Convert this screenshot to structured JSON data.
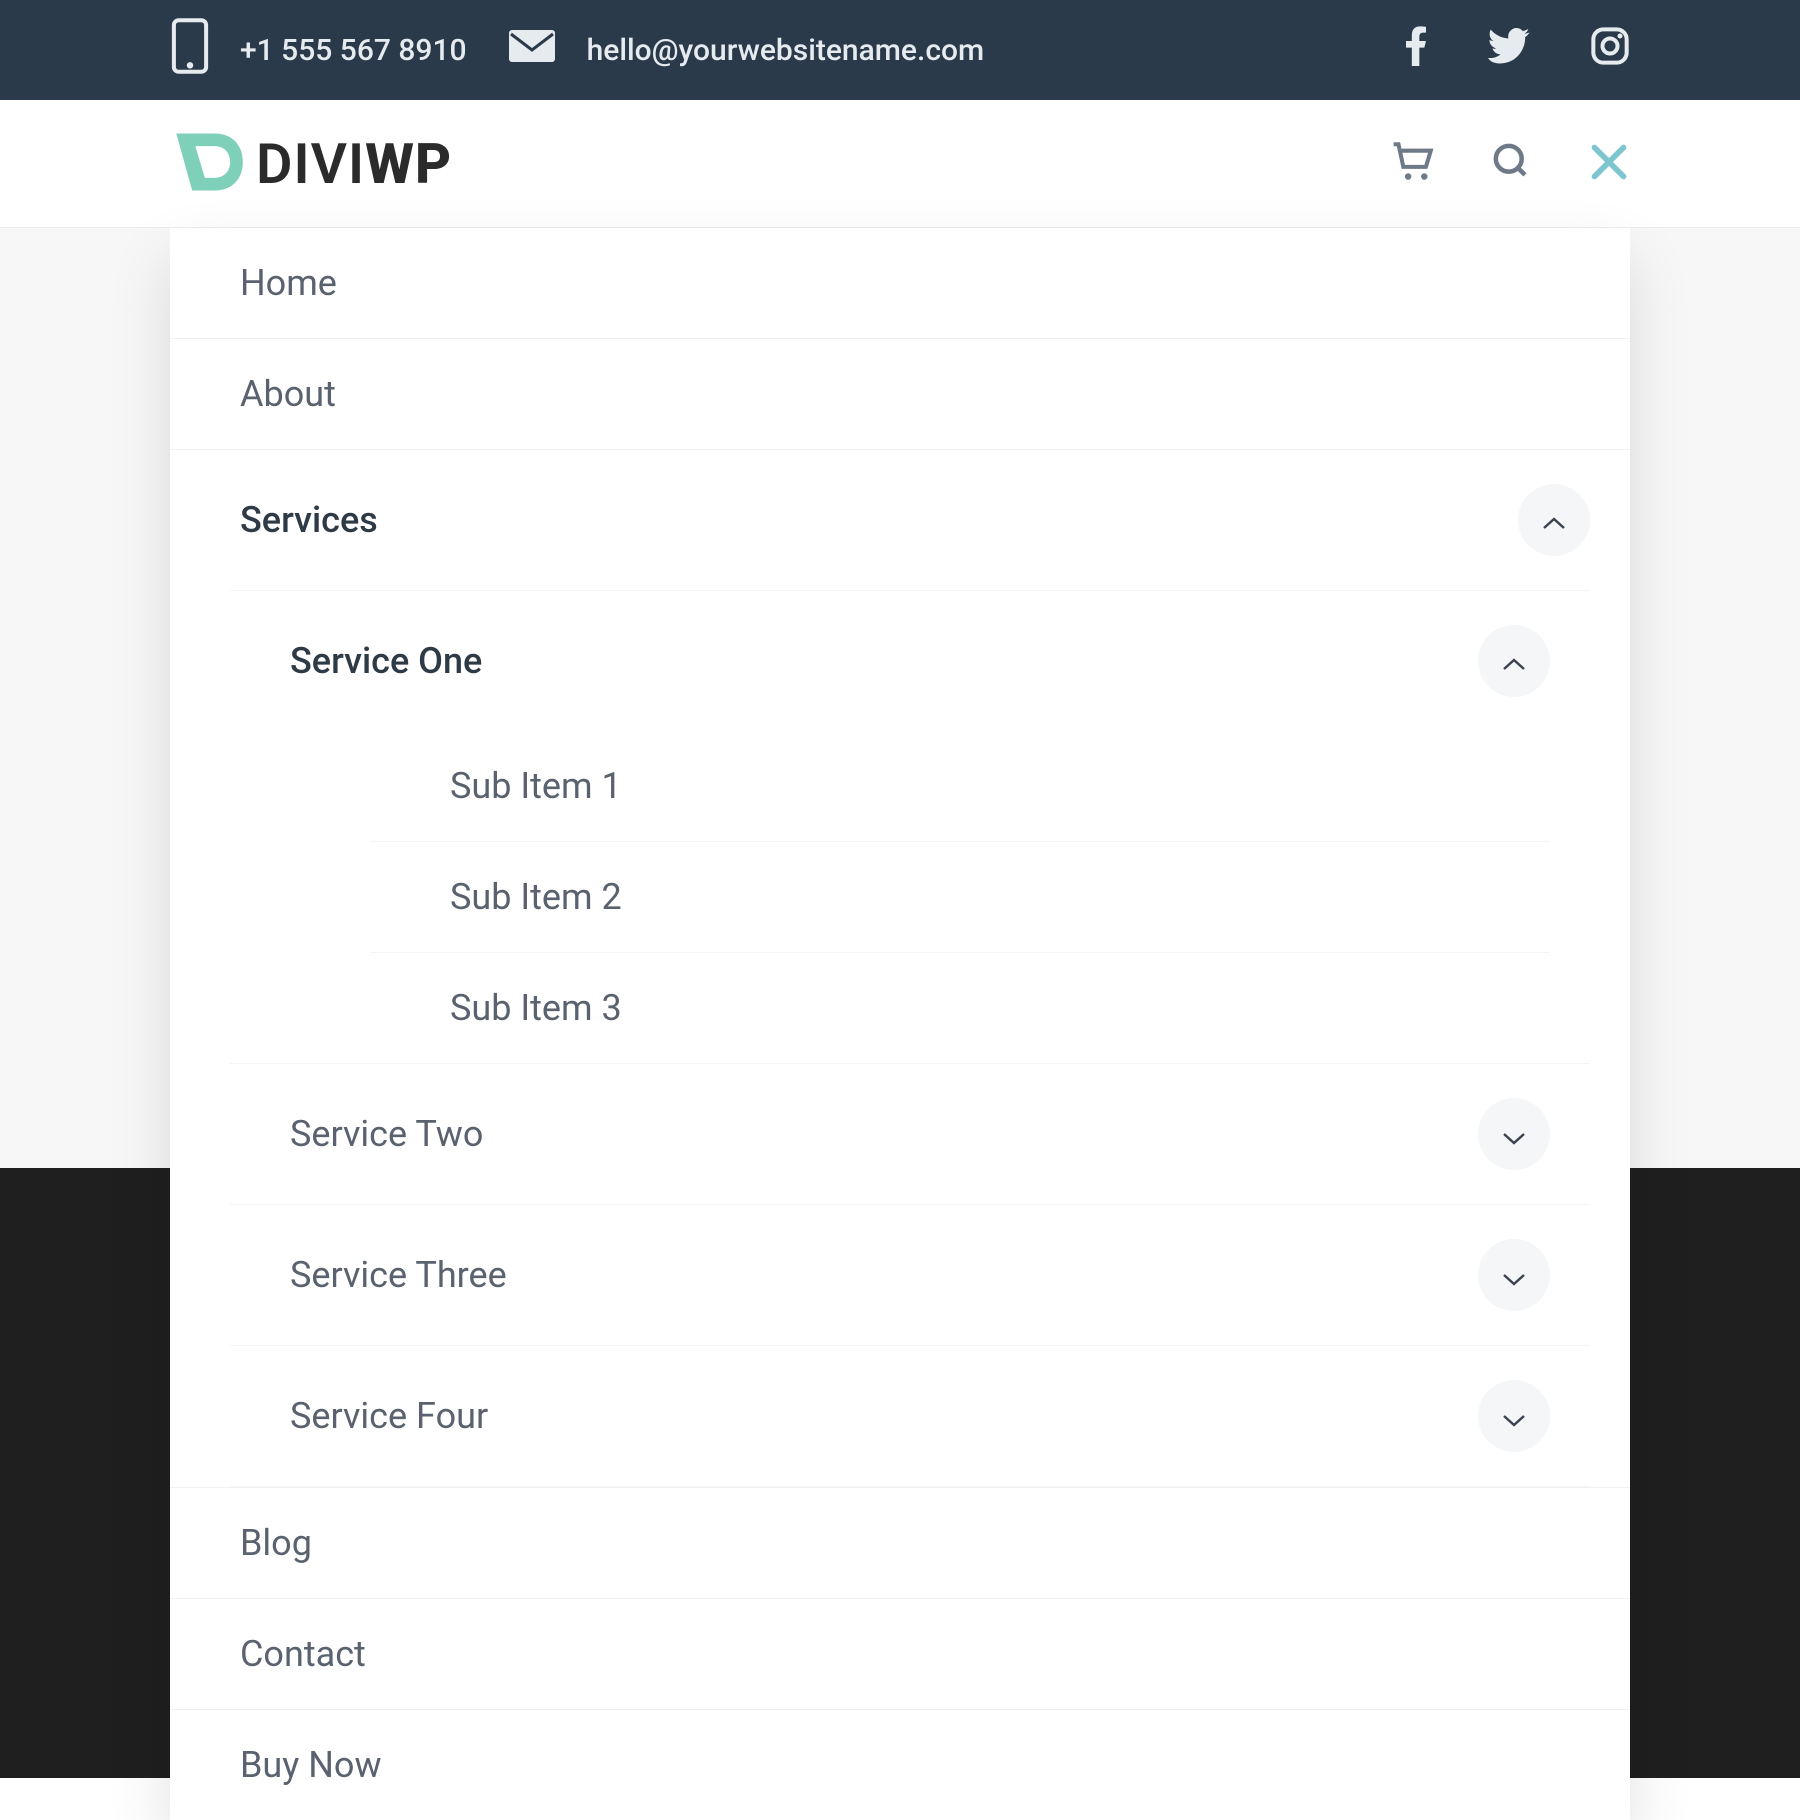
{
  "topbar": {
    "phone": "+1 555 567 8910",
    "email": "hello@yourwebsitename.com",
    "social": [
      "facebook",
      "twitter",
      "instagram"
    ]
  },
  "logo": {
    "brand": "DIVI",
    "suffix": "WP"
  },
  "menu": {
    "home": "Home",
    "about": "About",
    "services": "Services",
    "service_one": "Service One",
    "sub1": "Sub Item 1",
    "sub2": "Sub Item 2",
    "sub3": "Sub Item 3",
    "service_two": "Service Two",
    "service_three": "Service Three",
    "service_four": "Service Four",
    "blog": "Blog",
    "contact": "Contact",
    "buy_now": "Buy Now"
  }
}
